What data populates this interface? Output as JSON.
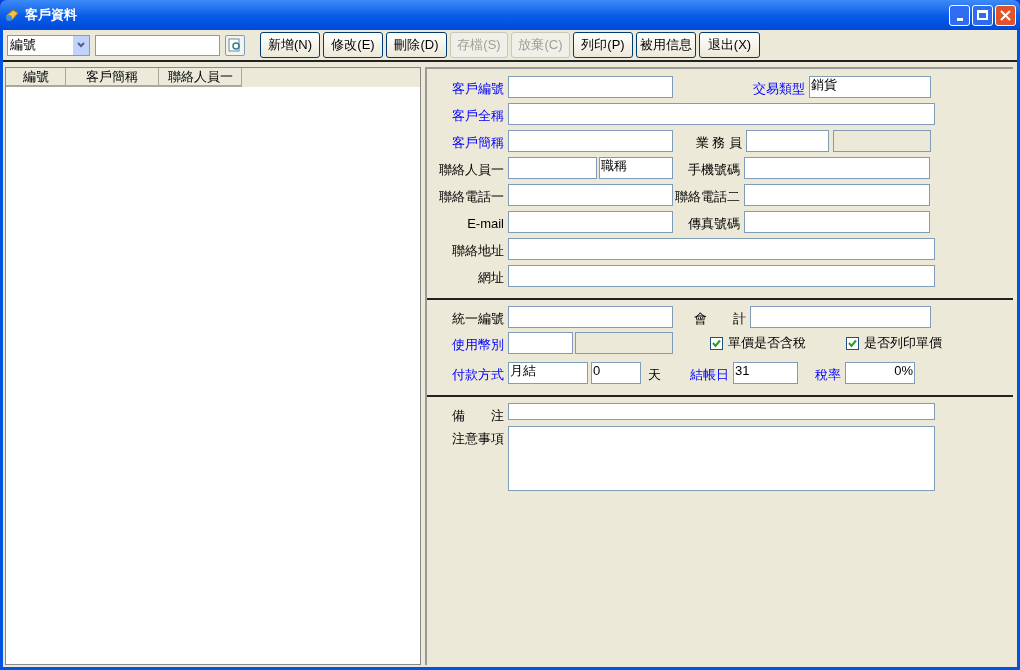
{
  "window": {
    "title": "客戶資料"
  },
  "toolbar": {
    "search_by": "編號",
    "buttons": [
      {
        "label": "新增(N)",
        "disabled": false
      },
      {
        "label": "修改(E)",
        "disabled": false
      },
      {
        "label": "刪除(D)",
        "disabled": false
      },
      {
        "label": "存檔(S)",
        "disabled": true
      },
      {
        "label": "放棄(C)",
        "disabled": true
      },
      {
        "label": "列印(P)",
        "disabled": false
      },
      {
        "label": "被用信息",
        "disabled": false
      },
      {
        "label": "退出(X)",
        "disabled": false
      }
    ]
  },
  "list": {
    "columns": [
      "編號",
      "客戶簡稱",
      "聯絡人員一"
    ]
  },
  "form": {
    "sections": [
      {
        "rows": [
          {
            "items": [
              {
                "kind": "field",
                "label": "客戶編號",
                "required": true,
                "inputs": [
                  {
                    "disabled": false
                  }
                ]
              },
              {
                "kind": "field",
                "label": "交易類型",
                "required": true,
                "inputs": [
                  {
                    "disabled": false,
                    "value": "銷貨"
                  }
                ]
              }
            ]
          },
          {
            "items": [
              {
                "kind": "field",
                "label": "客戶全稱",
                "required": true,
                "inputs": [
                  {
                    "disabled": false
                  }
                ]
              }
            ]
          },
          {
            "items": [
              {
                "kind": "field",
                "label": "客戶簡稱",
                "required": true,
                "inputs": [
                  {
                    "disabled": false
                  }
                ]
              },
              {
                "kind": "field",
                "label": "業 務 員",
                "required": false,
                "inputs": [
                  {
                    "disabled": false
                  },
                  {
                    "disabled": true
                  }
                ]
              }
            ]
          },
          {
            "items": [
              {
                "kind": "field",
                "label": "聯絡人員一",
                "required": false,
                "inputs": [
                  {
                    "disabled": false
                  },
                  {
                    "disabled": false,
                    "value": "職稱"
                  }
                ]
              },
              {
                "kind": "field",
                "label": "手機號碼",
                "required": false,
                "inputs": [
                  {
                    "disabled": false
                  }
                ]
              }
            ]
          },
          {
            "items": [
              {
                "kind": "field",
                "label": "聯絡電話一",
                "required": false,
                "inputs": [
                  {
                    "disabled": false
                  }
                ]
              },
              {
                "kind": "field",
                "label": "聯絡電話二",
                "required": false,
                "inputs": [
                  {
                    "disabled": false
                  }
                ]
              }
            ]
          },
          {
            "items": [
              {
                "kind": "field",
                "label": "E-mail",
                "required": false,
                "inputs": [
                  {
                    "disabled": false
                  }
                ]
              },
              {
                "kind": "field",
                "label": "傳真號碼",
                "required": false,
                "inputs": [
                  {
                    "disabled": false
                  }
                ]
              }
            ]
          },
          {
            "items": [
              {
                "kind": "field",
                "label": "聯絡地址",
                "required": false,
                "inputs": [
                  {
                    "disabled": false
                  }
                ]
              }
            ]
          },
          {
            "items": [
              {
                "kind": "field",
                "label": "網址",
                "required": false,
                "inputs": [
                  {
                    "disabled": false
                  }
                ]
              }
            ]
          }
        ]
      },
      {
        "rows": [
          {
            "items": [
              {
                "kind": "field",
                "label": "統一編號",
                "required": false,
                "inputs": [
                  {
                    "disabled": false
                  }
                ]
              },
              {
                "kind": "field",
                "label": "會　　計",
                "required": false,
                "inputs": [
                  {
                    "disabled": false
                  }
                ]
              }
            ]
          },
          {
            "items": [
              {
                "kind": "field",
                "label": "使用幣別",
                "required": true,
                "inputs": [
                  {
                    "disabled": false
                  },
                  {
                    "disabled": true
                  }
                ]
              },
              {
                "kind": "checkbox",
                "label": "單價是否含稅",
                "checked": true
              },
              {
                "kind": "checkbox",
                "label": "是否列印單價",
                "checked": true
              }
            ]
          },
          {
            "items": [
              {
                "kind": "field",
                "label": "付款方式",
                "required": true,
                "inputs": [
                  {
                    "disabled": false,
                    "value": "月結"
                  },
                  {
                    "disabled": false,
                    "value": "0"
                  }
                ],
                "unit": "天"
              },
              {
                "kind": "field",
                "label": "結帳日",
                "required": true,
                "inputs": [
                  {
                    "disabled": false,
                    "value": "31"
                  }
                ]
              },
              {
                "kind": "field",
                "label": "稅率",
                "required": true,
                "inputs": [
                  {
                    "disabled": false,
                    "value": "0%"
                  }
                ]
              }
            ]
          }
        ]
      },
      {
        "rows": [
          {
            "items": [
              {
                "kind": "field",
                "label": "備　　注",
                "required": false,
                "inputs": [
                  {
                    "disabled": false
                  }
                ]
              }
            ]
          },
          {
            "items": [
              {
                "kind": "memo",
                "label": "注意事項",
                "required": false
              }
            ]
          }
        ]
      }
    ]
  }
}
